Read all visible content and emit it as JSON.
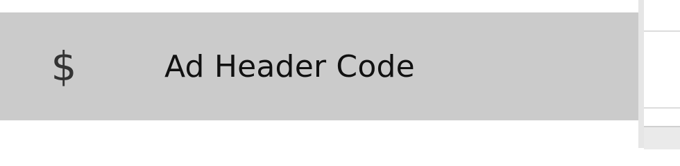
{
  "menu": {
    "active_item": {
      "icon": "dollar-icon",
      "icon_glyph": "$",
      "label": "Ad Header Code"
    }
  },
  "colors": {
    "active_background": "#cbcbcb",
    "icon_color": "#333333",
    "label_color": "#111111"
  }
}
